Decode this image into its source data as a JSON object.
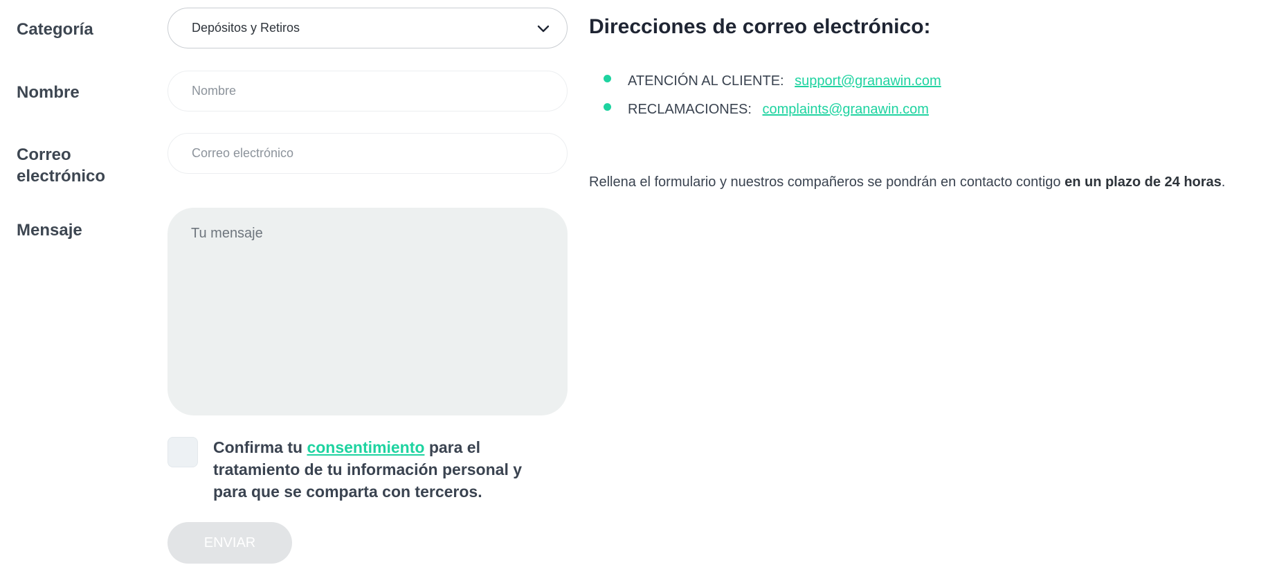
{
  "form": {
    "category": {
      "label": "Categoría",
      "selected": "Depósitos y Retiros"
    },
    "name": {
      "label": "Nombre",
      "placeholder": "Nombre"
    },
    "email": {
      "label_line1": "Correo",
      "label_line2": "electrónico",
      "placeholder": "Correo electrónico"
    },
    "message": {
      "label": "Mensaje",
      "placeholder": "Tu mensaje"
    },
    "consent": {
      "prefix": "Confirma tu",
      "link": "consentimiento",
      "suffix": "para el tratamiento de tu información personal y para que se comparta con terceros."
    },
    "submit_label": "ENVIAR"
  },
  "contact": {
    "heading": "Direcciones de correo electrónico:",
    "emails": [
      {
        "label": "ATENCIÓN AL CLIENTE:",
        "address": "support@granawin.com"
      },
      {
        "label": "RECLAMACIONES:",
        "address": "complaints@granawin.com"
      }
    ],
    "note": {
      "text": "Rellena el formulario y nuestros compañeros se pondrán en contacto contigo",
      "emphasis": "en un plazo de 24 horas",
      "end": "."
    }
  },
  "colors": {
    "accent": "#1ed3a0",
    "text": "#3a4350",
    "textarea_bg": "#edf0f0",
    "button_disabled": "#e2e4e6"
  },
  "icons": {
    "select": "chevron-down-icon",
    "bullet": "bullet-dot-icon"
  }
}
